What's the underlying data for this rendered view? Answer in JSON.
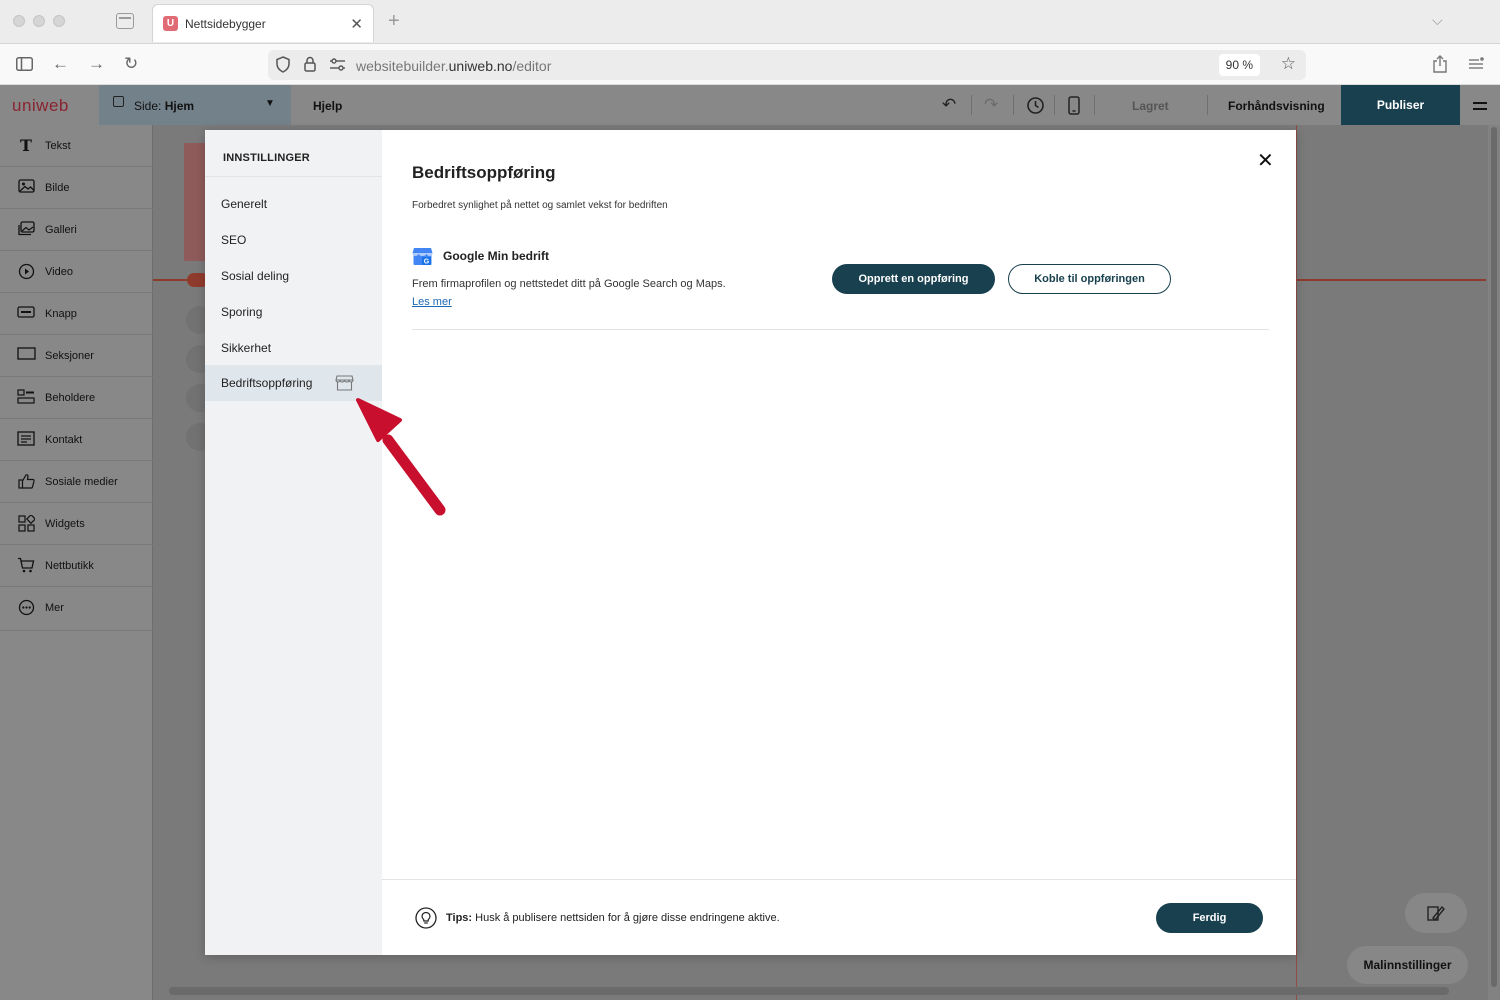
{
  "browser": {
    "tab_title": "Nettsidebygger",
    "tab_favicon_letter": "U",
    "url_host_prefix": "websitebuilder.",
    "url_host": "uniweb.no",
    "url_path": "/editor",
    "zoom": "90 %",
    "icons": [
      "sidebar-toggle-icon",
      "back-icon",
      "forward-icon",
      "reload-icon",
      "shield-icon",
      "lock-icon",
      "site-settings-icon",
      "star-icon",
      "share-icon",
      "menu-icon"
    ]
  },
  "app": {
    "logo": "uniweb",
    "page_prefix": "Side: ",
    "page_name": "Hjem",
    "help": "Hjelp",
    "saved": "Lagret",
    "preview": "Forhåndsvisning",
    "publish": "Publiser",
    "accent": "#18404f"
  },
  "sidebar": {
    "items": [
      {
        "label": "Tekst",
        "icon": "text-icon"
      },
      {
        "label": "Bilde",
        "icon": "image-icon"
      },
      {
        "label": "Galleri",
        "icon": "gallery-icon"
      },
      {
        "label": "Video",
        "icon": "video-icon"
      },
      {
        "label": "Knapp",
        "icon": "button-icon"
      },
      {
        "label": "Seksjoner",
        "icon": "sections-icon"
      },
      {
        "label": "Beholdere",
        "icon": "containers-icon"
      },
      {
        "label": "Kontakt",
        "icon": "contact-icon"
      },
      {
        "label": "Sosiale medier",
        "icon": "social-icon"
      },
      {
        "label": "Widgets",
        "icon": "widgets-icon"
      },
      {
        "label": "Nettbutikk",
        "icon": "cart-icon"
      },
      {
        "label": "Mer",
        "icon": "more-icon"
      }
    ]
  },
  "modal": {
    "nav_heading": "INNSTILLINGER",
    "nav_items": [
      "Generelt",
      "SEO",
      "Sosial deling",
      "Sporing",
      "Sikkerhet",
      "Bedriftsoppføring"
    ],
    "active_item": "Bedriftsoppføring",
    "title": "Bedriftsoppføring",
    "subtitle": "Forbedret synlighet på nettet og samlet vekst for bedriften",
    "gmb_title": "Google Min bedrift",
    "gmb_desc": "Frem firmaprofilen og nettstedet ditt på Google Search og Maps.",
    "gmb_link": "Les mer",
    "btn_create": "Opprett en oppføring",
    "btn_connect": "Koble til oppføringen",
    "tip_label": "Tips:",
    "tip_text": " Husk å publisere nettsiden for å gjøre disse endringene aktive.",
    "done": "Ferdig"
  },
  "canvas": {
    "template_settings": "Malinnstillinger"
  }
}
